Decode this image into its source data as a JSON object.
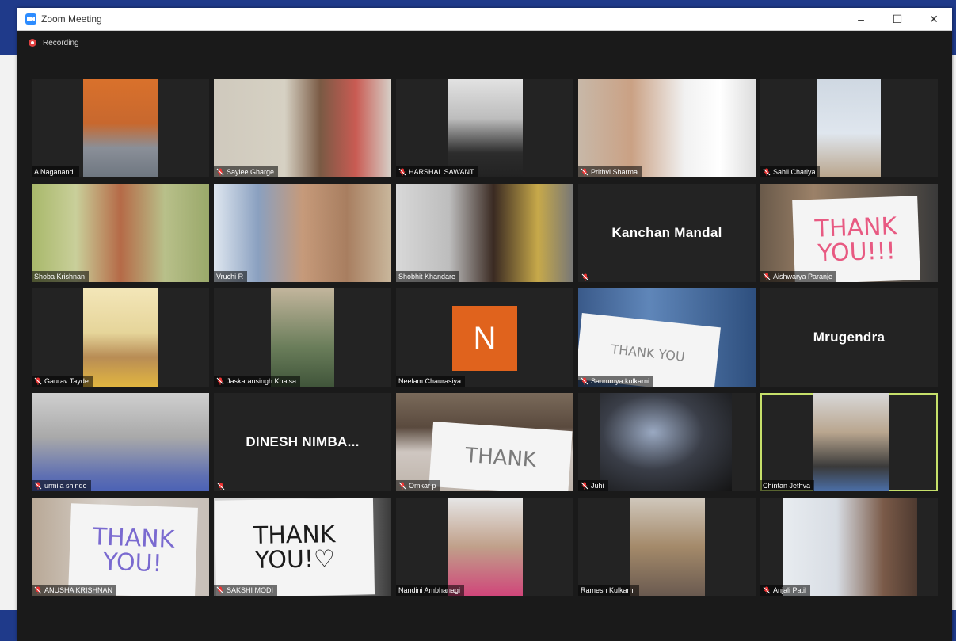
{
  "window": {
    "title": "Zoom Meeting",
    "icon": "zoom-camera-icon",
    "controls": {
      "minimize": "–",
      "maximize": "☐",
      "close": "✕"
    }
  },
  "recording": {
    "label": "Recording",
    "color": "#e04040"
  },
  "colors": {
    "accent": "#2d8cff",
    "active_speaker_border": "#c6e06a",
    "tile_bg": "#232323",
    "avatar_bg": "#e0631d"
  },
  "participants": [
    {
      "name": "A Naganandi",
      "muted": false,
      "video": true
    },
    {
      "name": "Saylee Gharge",
      "muted": true,
      "video": true
    },
    {
      "name": "HARSHAL SAWANT",
      "muted": true,
      "video": true
    },
    {
      "name": "Prithvi Sharma",
      "muted": true,
      "video": true
    },
    {
      "name": "Sahil Chariya",
      "muted": true,
      "video": true
    },
    {
      "name": "Shoba Krishnan",
      "muted": false,
      "video": true
    },
    {
      "name": "Vruchi R",
      "muted": false,
      "video": true
    },
    {
      "name": "Shobhit Khandare",
      "muted": false,
      "video": true
    },
    {
      "name": "Kanchan Mandal",
      "muted": true,
      "video": false
    },
    {
      "name": "Aishwarya Paranje",
      "muted": true,
      "video": true,
      "sign": "THANK\nYOU!!!"
    },
    {
      "name": "Gaurav Tayde",
      "muted": true,
      "video": true
    },
    {
      "name": "Jaskaransingh Khalsa",
      "muted": true,
      "video": true
    },
    {
      "name": "Neelam Chaurasiya",
      "muted": false,
      "video": false,
      "avatar": "N"
    },
    {
      "name": "Saummya kulkarni",
      "muted": true,
      "video": true,
      "sign": "THANK YOU"
    },
    {
      "name": "Mrugendra",
      "muted": false,
      "video": false
    },
    {
      "name": "urmila shinde",
      "muted": true,
      "video": true
    },
    {
      "name": "DINESH  NIMBA...",
      "muted": true,
      "video": false
    },
    {
      "name": "Omkar p",
      "muted": true,
      "video": true,
      "sign": "THANK"
    },
    {
      "name": "Juhi",
      "muted": true,
      "video": true
    },
    {
      "name": "Chintan Jethva",
      "muted": false,
      "video": true,
      "active": true
    },
    {
      "name": "ANUSHA KRISHNAN",
      "muted": true,
      "video": true,
      "sign": "THANK\nYOU!"
    },
    {
      "name": "SAKSHI MODI",
      "muted": true,
      "video": true,
      "sign": "THANK\nYOU!♡"
    },
    {
      "name": "Nandini Ambhanagi",
      "muted": false,
      "video": true
    },
    {
      "name": "Ramesh Kulkarni",
      "muted": false,
      "video": true
    },
    {
      "name": "Anjali Patil",
      "muted": true,
      "video": true
    }
  ]
}
